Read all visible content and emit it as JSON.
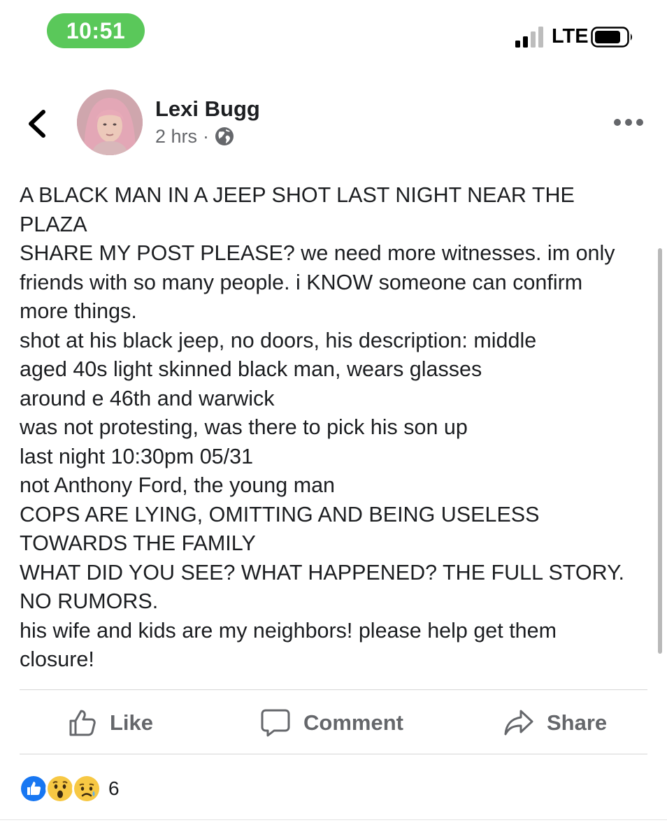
{
  "status_bar": {
    "time": "10:51",
    "carrier": "LTE",
    "time_pill_color": "#5ac85a"
  },
  "post": {
    "author": "Lexi Bugg",
    "time_ago": "2 hrs",
    "separator": "·",
    "privacy_icon": "globe-icon",
    "lines": [
      "A BLACK MAN IN A JEEP SHOT LAST NIGHT NEAR THE",
      "PLAZA",
      "SHARE MY POST PLEASE? we need more witnesses. im only",
      "friends with so many people. i KNOW someone can confirm",
      "more things.",
      "shot at his black jeep, no doors, his description: middle",
      "aged 40s light skinned black man, wears glasses",
      "around e 46th and warwick",
      "was not protesting, was there to pick his son up",
      "last night 10:30pm 05/31",
      "not Anthony Ford, the young man",
      "COPS ARE LYING, OMITTING AND BEING USELESS",
      "TOWARDS THE FAMILY",
      "WHAT DID YOU SEE? WHAT HAPPENED? THE FULL STORY.",
      "NO RUMORS.",
      "his wife and kids are my neighbors! please help get them",
      "closure!"
    ]
  },
  "actions": {
    "like": "Like",
    "comment": "Comment",
    "share": "Share"
  },
  "reactions": {
    "icons": [
      "like-reaction-icon",
      "wow-reaction-icon",
      "sad-reaction-icon"
    ],
    "count": "6"
  },
  "colors": {
    "text": "#1c1e21",
    "secondary_text": "#65676b",
    "like_blue": "#1877f2",
    "reaction_yellow": "#f7c844"
  }
}
